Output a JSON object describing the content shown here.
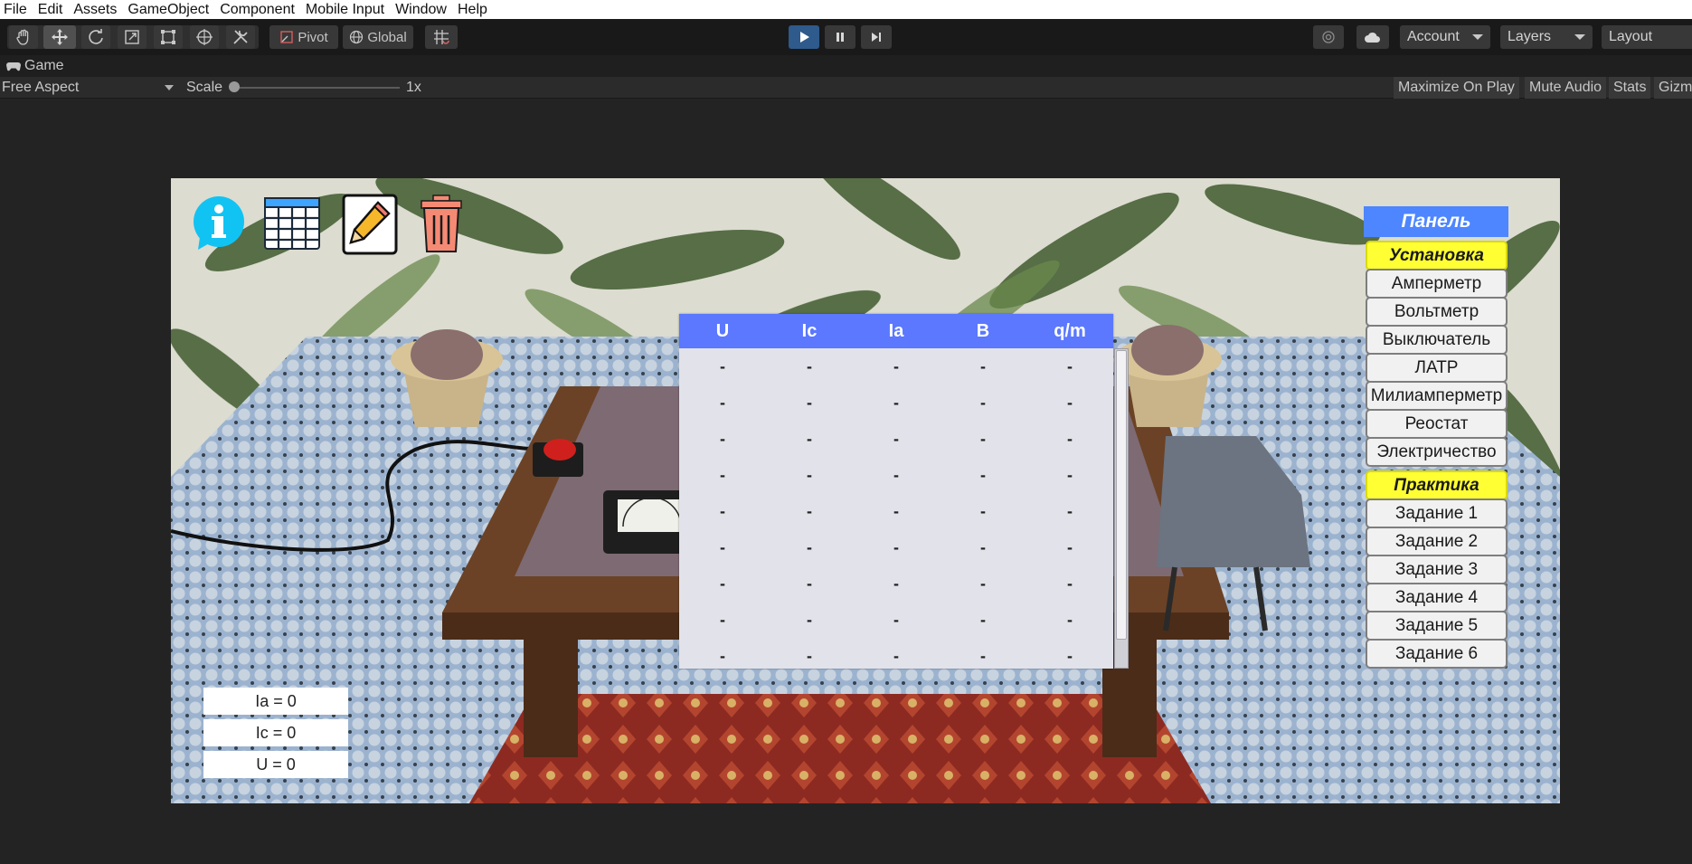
{
  "menu": {
    "items": [
      "File",
      "Edit",
      "Assets",
      "GameObject",
      "Component",
      "Mobile Input",
      "Window",
      "Help"
    ]
  },
  "toolbar": {
    "pivot_label": "Pivot",
    "global_label": "Global",
    "account_label": "Account",
    "layers_label": "Layers",
    "layout_label": "Layout",
    "play_active": true
  },
  "game_tab": {
    "title": "Game"
  },
  "game_bar": {
    "aspect": "Free Aspect",
    "scale_label": "Scale",
    "scale_value": "1x",
    "options": [
      "Maximize On Play",
      "Mute Audio",
      "Stats",
      "Gizm"
    ]
  },
  "scene": {
    "icons": [
      "info-icon",
      "table-icon",
      "pencil-icon",
      "trash-icon"
    ],
    "table": {
      "headers": [
        "U",
        "Ic",
        "Ia",
        "B",
        "q/m"
      ],
      "rows": [
        [
          "-",
          "-",
          "-",
          "-",
          "-"
        ],
        [
          "-",
          "-",
          "-",
          "-",
          "-"
        ],
        [
          "-",
          "-",
          "-",
          "-",
          "-"
        ],
        [
          "-",
          "-",
          "-",
          "-",
          "-"
        ],
        [
          "-",
          "-",
          "-",
          "-",
          "-"
        ],
        [
          "-",
          "-",
          "-",
          "-",
          "-"
        ],
        [
          "-",
          "-",
          "-",
          "-",
          "-"
        ],
        [
          "-",
          "-",
          "-",
          "-",
          "-"
        ],
        [
          "-",
          "-",
          "-",
          "-",
          "-"
        ]
      ]
    },
    "panel": {
      "title": "Панель",
      "setup_header": "Установка",
      "setup_items": [
        "Амперметр",
        "Вольтметр",
        "Выключатель",
        "ЛАТР",
        "Милиамперметр",
        "Реостат",
        "Электричество"
      ],
      "practice_header": "Практика",
      "practice_items": [
        "Задание 1",
        "Задание 2",
        "Задание 3",
        "Задание 4",
        "Задание 5",
        "Задание 6"
      ]
    },
    "readouts": [
      "Ia = 0",
      "Ic = 0",
      "U = 0"
    ]
  },
  "colors": {
    "panel_blue": "#4d86ff",
    "table_header_blue": "#5b78ff",
    "highlight_yellow": "#ffff33",
    "info_cyan": "#11c3f3"
  }
}
